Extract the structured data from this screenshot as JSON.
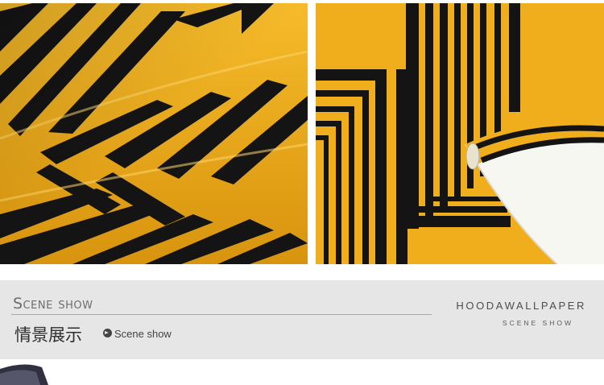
{
  "photos": {
    "left": {
      "icon": "chevron-wallpaper-roll-photo"
    },
    "right": {
      "icon": "stripe-wallpaper-roll-photo"
    }
  },
  "banner": {
    "title": "Scene show",
    "title_cn": "情景展示",
    "subtitle": "Scene show",
    "brand": "HOODAWALLPAPER",
    "brand_sub": "SCENE SHOW"
  },
  "colors": {
    "wallpaper_yellow": "#f0ae1c",
    "stripe_black": "#141414",
    "banner_gray": "#e6e6e6"
  }
}
